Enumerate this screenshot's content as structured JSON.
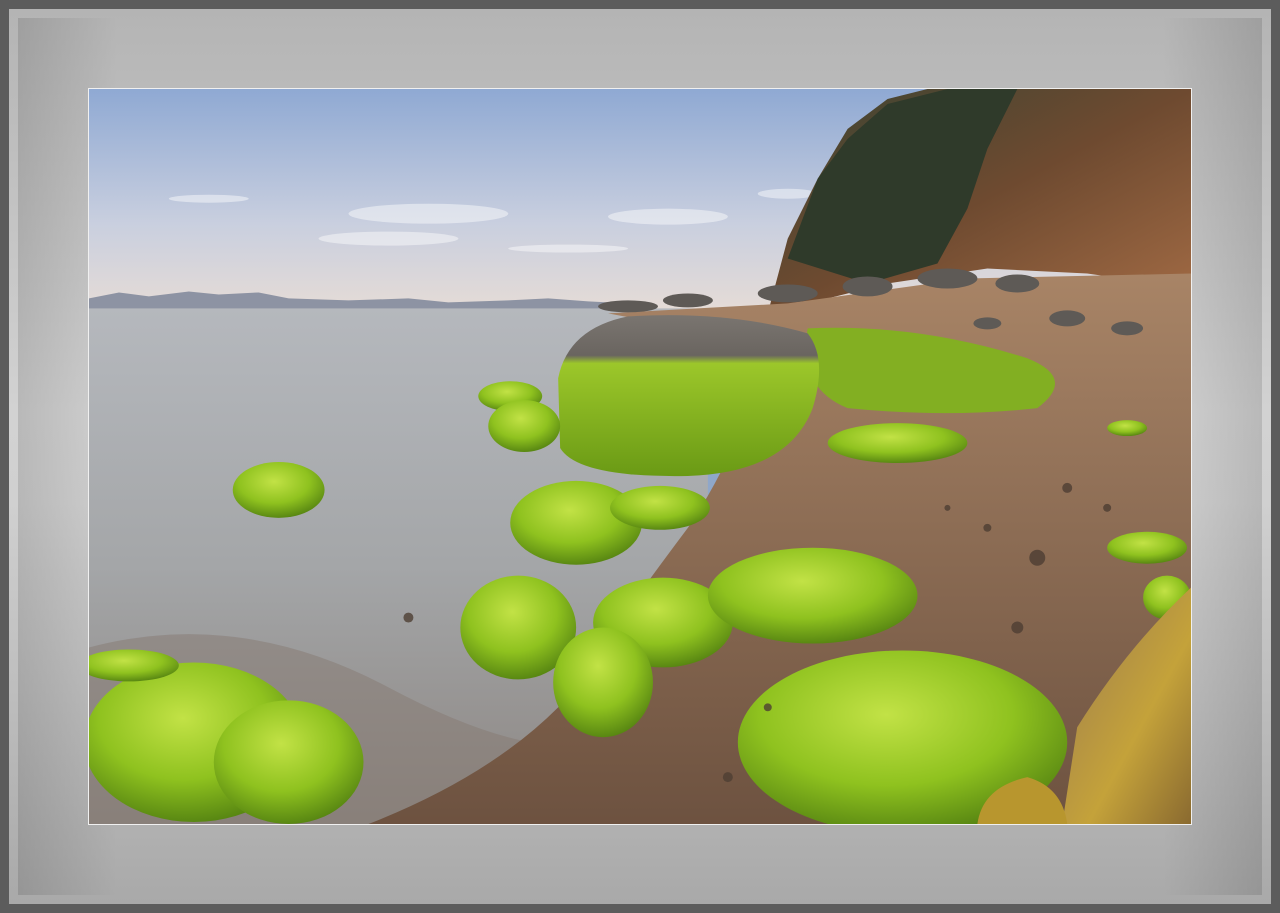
{
  "scene": {
    "subject": "",
    "colors": {
      "sky_top": "#8fa9d3",
      "sky_bottom": "#e2dcdc",
      "sea": "#a9aeb3",
      "sand": "#8a6a52",
      "moss": "#8fc21f",
      "moss_light": "#b5dc3a",
      "moss_dark": "#5a8a12",
      "rock": "#6f6a66",
      "cliff": "#8a5a3c",
      "trees": "#2e3a2a",
      "frame_outer": "#5c5c5c",
      "frame_mat": "#cfcfcf"
    }
  }
}
